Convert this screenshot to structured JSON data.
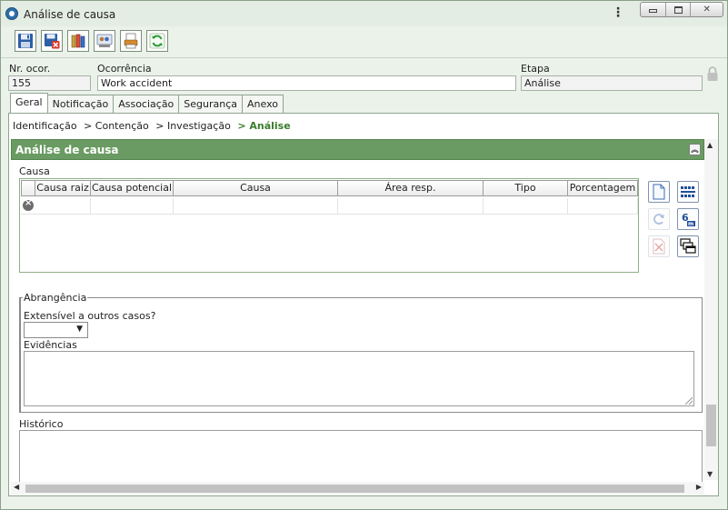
{
  "window": {
    "title": "Análise de causa"
  },
  "toolbar": {
    "buttons": [
      "save",
      "save-and-close",
      "attachments",
      "view-users",
      "print-report",
      "refresh"
    ]
  },
  "header": {
    "nr_ocor_label": "Nr. ocor.",
    "nr_ocor_value": "155",
    "ocorrencia_label": "Ocorrência",
    "ocorrencia_value": "Work accident",
    "etapa_label": "Etapa",
    "etapa_value": "Análise"
  },
  "tabs": [
    {
      "label": "Geral",
      "active": true
    },
    {
      "label": "Notificação",
      "active": false
    },
    {
      "label": "Associação",
      "active": false
    },
    {
      "label": "Segurança",
      "active": false
    },
    {
      "label": "Anexo",
      "active": false
    }
  ],
  "breadcrumb": {
    "items": [
      "Identificação",
      "> Contenção",
      "> Investigação"
    ],
    "current": "> Análise"
  },
  "section": {
    "title": "Análise de causa"
  },
  "causa": {
    "label": "Causa",
    "columns": [
      "Causa raiz",
      "Causa potencial",
      "Causa",
      "Área resp.",
      "Tipo",
      "Porcentagem"
    ]
  },
  "abrangencia": {
    "legend": "Abrangência",
    "extensivel_label": "Extensível a outros casos?",
    "extensivel_value": "",
    "evidencias_label": "Evidências",
    "evidencias_value": ""
  },
  "historico": {
    "label": "Histórico",
    "value": ""
  },
  "colors": {
    "section_header": "#6a9b62",
    "breadcrumb_current": "#3b7d2c",
    "window_bg": "#ebf2ea"
  }
}
